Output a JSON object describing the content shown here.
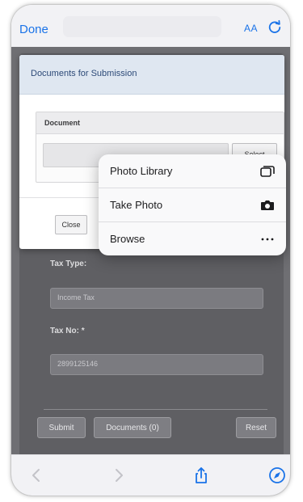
{
  "browser": {
    "done_label": "Done",
    "text_size_label": "AA",
    "icons": {
      "reload": "reload-icon",
      "back": "chevron-left-icon",
      "forward": "chevron-right-icon",
      "share": "share-icon",
      "compass": "compass-icon"
    }
  },
  "modal": {
    "title": "Documents for Submission",
    "document_header": "Document",
    "select_label": "Select",
    "close_label": "Close"
  },
  "popover": {
    "items": [
      {
        "label": "Photo Library",
        "icon": "photo-library-icon"
      },
      {
        "label": "Take Photo",
        "icon": "camera-icon"
      },
      {
        "label": "Browse",
        "icon": "ellipsis-icon"
      }
    ]
  },
  "form": {
    "tax_type_label": "Tax Type:",
    "tax_type_value": "Income Tax",
    "tax_no_label": "Tax No: *",
    "tax_no_value": "2899125146",
    "submit_label": "Submit",
    "documents_label": "Documents (0)",
    "reset_label": "Reset"
  },
  "colors": {
    "accent": "#1a73e8",
    "modal_header": "#dfe7f1",
    "overlay": "#6f6f73"
  }
}
